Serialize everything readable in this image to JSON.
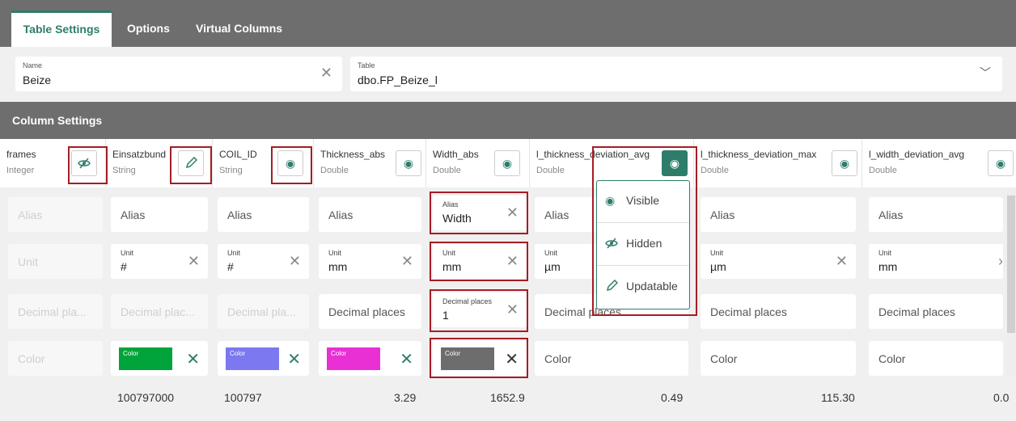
{
  "tabs": [
    "Table Settings",
    "Options",
    "Virtual Columns"
  ],
  "form": {
    "name_label": "Name",
    "name_value": "Beize",
    "table_label": "Table",
    "table_value": "dbo.FP_Beize_l"
  },
  "section_title": "Column Settings",
  "columns": [
    {
      "name": "frames",
      "type": "Integer"
    },
    {
      "name": "Einsatzbund",
      "type": "String"
    },
    {
      "name": "COIL_ID",
      "type": "String"
    },
    {
      "name": "Thickness_abs",
      "type": "Double"
    },
    {
      "name": "Width_abs",
      "type": "Double"
    },
    {
      "name": "l_thickness_deviation_avg",
      "type": "Double"
    },
    {
      "name": "l_thickness_deviation_max",
      "type": "Double"
    },
    {
      "name": "l_width_deviation_avg",
      "type": "Double"
    }
  ],
  "alias_row": [
    "Alias",
    "Alias",
    "Alias",
    "Alias",
    "Width",
    "Alias",
    "Alias",
    "Alias"
  ],
  "alias_label": "Alias",
  "unit_label": "Unit",
  "unit_row": [
    "Unit",
    "#",
    "#",
    "mm",
    "mm",
    "µm",
    "µm",
    "mm"
  ],
  "decimal_label": "Decimal places",
  "decimal_row": [
    "Decimal pla...",
    "Decimal plac...",
    "Decimal pla...",
    "Decimal places",
    "1",
    "Decimal places",
    "Decimal places",
    "Decimal places"
  ],
  "color_label": "Color",
  "color_swatch_label": "Color",
  "colors": [
    "#00a43a",
    "#7b78f0",
    "#e830d4",
    "#6d6d6d"
  ],
  "totals": [
    "",
    "100797000",
    "100797",
    "3.29",
    "1652.9",
    "0.49",
    "115.30",
    "0.0"
  ],
  "visibility_menu": [
    "Visible",
    "Hidden",
    "Updatable"
  ]
}
